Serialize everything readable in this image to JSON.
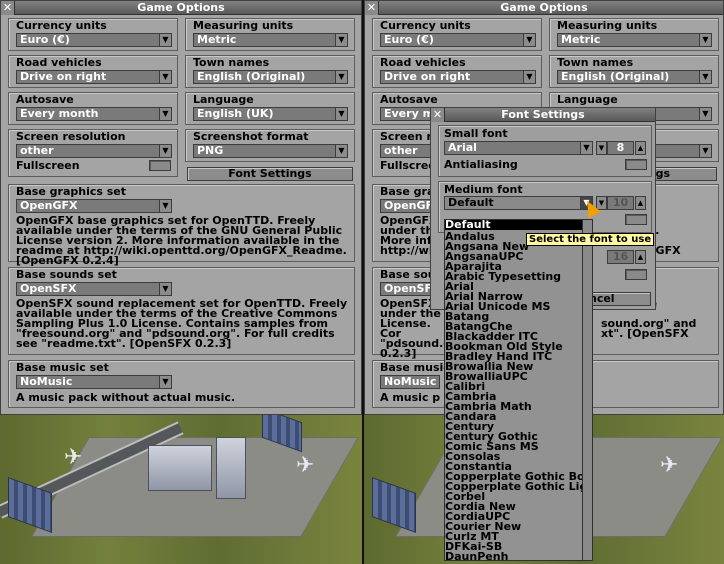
{
  "options_window": {
    "title": "Game Options",
    "currency": {
      "label": "Currency units",
      "value": "Euro (€)"
    },
    "measuring": {
      "label": "Measuring units",
      "value": "Metric"
    },
    "road": {
      "label": "Road vehicles",
      "value": "Drive on right"
    },
    "town": {
      "label": "Town names",
      "value": "English (Original)"
    },
    "autosave": {
      "label": "Autosave",
      "value": "Every month"
    },
    "language": {
      "label": "Language",
      "value": "English (UK)"
    },
    "resolution": {
      "label": "Screen resolution",
      "value": "other",
      "fullscreen_label": "Fullscreen"
    },
    "screenshot": {
      "label": "Screenshot format",
      "value": "PNG"
    },
    "font_settings_button": "Font Settings",
    "graphics": {
      "label": "Base graphics set",
      "value": "OpenGFX",
      "description": "OpenGFX base graphics set for OpenTTD. Freely available under the terms of the GNU General Public License version 2. More information available in the readme at http://wiki.openttd.org/OpenGFX_Readme. [OpenGFX 0.2.4]"
    },
    "sounds": {
      "label": "Base sounds set",
      "value": "OpenSFX",
      "description": "OpenSFX sound replacement set for OpenTTD. Freely available under the terms of the Creative Commons Sampling Plus 1.0 License. Contains samples from \"freesound.org\" and \"pdsound.org\". For full credits see \"readme.txt\". [OpenSFX 0.2.3]"
    },
    "music": {
      "label": "Base music set",
      "value": "NoMusic",
      "description": "A music pack without actual music."
    }
  },
  "right_window": {
    "title": "Game Options",
    "currency_label": "Currency units",
    "currency_value": "Euro (€)",
    "measuring_label": "Measuring units",
    "measuring_value": "Metric",
    "road_label": "Road vehicles",
    "road_value": "Drive on right",
    "town_label": "Town names",
    "town_value": "English (Original)",
    "autosave_label": "Autosave",
    "autosave_value": "Every mo",
    "language_label": "Language",
    "resolution_label": "Screen res",
    "resolution_value": "other",
    "fullscreen_label": "Fullscreen",
    "gs_tail": "gs",
    "graphics_label": "Base grap",
    "graphics_value": "OpenGF",
    "graphics_desc": "OpenGFX\nunder th\nMore info\nhttp://wiki",
    "graphics_right": "able\nsion 2.\n\n[OpenGFX 0.2.4]",
    "sounds_label": "Base sound",
    "sounds_value": "OpenSFX",
    "sounds_desc": "OpenSFX\nunder the\nLicense. Cor\n\"pdsound.or\n0.2.3]",
    "sounds_right": "available\n\nsound.org\" and\nxt\". [OpenSFX",
    "music_label": "Base music s",
    "music_value": "NoMusic",
    "music_desc": "A music p"
  },
  "font_window": {
    "title": "Font Settings",
    "small_font": {
      "label": "Small font",
      "value": "Arial",
      "size": "8",
      "antialias_label": "Antialiasing"
    },
    "medium_font": {
      "label": "Medium font",
      "value": "Default",
      "size": "10"
    },
    "cancel_label": "ncel",
    "large_size": "16",
    "tooltip": "Select the font to use",
    "font_list": [
      "Default",
      "Andalus",
      "Angsana New",
      "AngsanaUPC",
      "Aparajita",
      "Arabic Typesetting",
      "Arial",
      "Arial Narrow",
      "Arial Unicode MS",
      "Batang",
      "BatangChe",
      "Blackadder ITC",
      "Bookman Old Style",
      "Bradley Hand ITC",
      "Browallia New",
      "BrowalliaUPC",
      "Calibri",
      "Cambria",
      "Cambria Math",
      "Candara",
      "Century",
      "Century Gothic",
      "Comic Sans MS",
      "Consolas",
      "Constantia",
      "Copperplate Gothic Bold",
      "Copperplate Gothic Light",
      "Corbel",
      "Cordia New",
      "CordiaUPC",
      "Courier New",
      "Curlz MT",
      "DFKai-SB",
      "DaunPenh"
    ]
  }
}
